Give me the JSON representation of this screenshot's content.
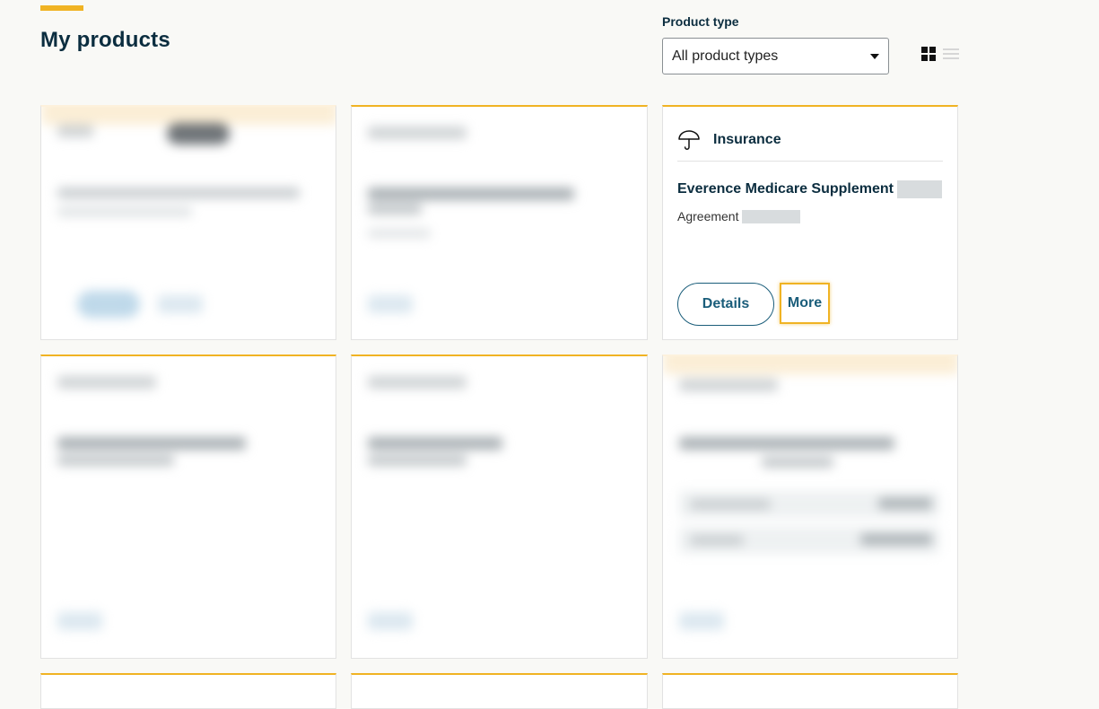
{
  "page": {
    "title": "My products"
  },
  "filter": {
    "label": "Product type",
    "selected": "All product types"
  },
  "view_toggle": {
    "grid_icon": "grid-view-icon",
    "list_icon": "list-view-icon",
    "active": "grid"
  },
  "insurance_card": {
    "category": "Insurance",
    "category_icon": "umbrella-icon",
    "product_name": "Everence Medicare Supplement",
    "agreement_label": "Agreement",
    "details_label": "Details",
    "more_label": "More"
  },
  "colors": {
    "accent": "#f0b323",
    "heading": "#0b2d3f",
    "link": "#1a5d7a",
    "background": "#f9f9f6"
  }
}
